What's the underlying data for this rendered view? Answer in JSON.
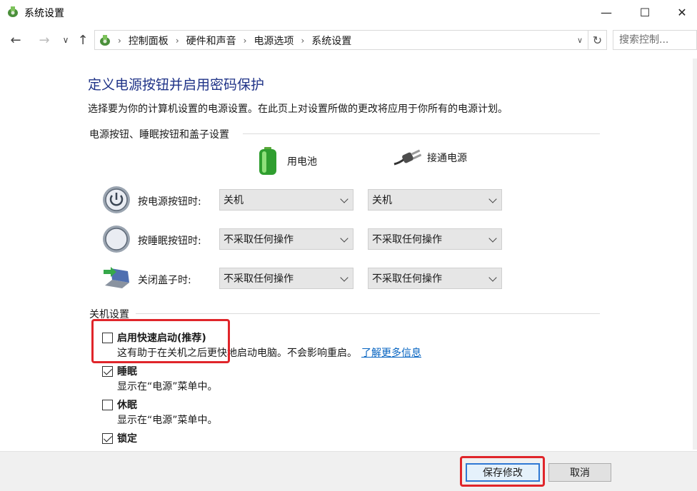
{
  "window": {
    "title": "系统设置",
    "minimize_glyph": "—",
    "maximize_glyph": "☐",
    "close_glyph": "✕"
  },
  "nav": {
    "back_glyph": "←",
    "forward_glyph": "→",
    "recent_glyph": "∨",
    "up_glyph": "↑",
    "refresh_glyph": "↻",
    "breadcrumbs": [
      "控制面板",
      "硬件和声音",
      "电源选项",
      "系统设置"
    ],
    "breadcrumb_sep": "›",
    "dropdown_glyph": "∨",
    "search_placeholder": "搜索控制..."
  },
  "main": {
    "title": "定义电源按钮并启用密码保护",
    "description": "选择要为你的计算机设置的电源设置。在此页上对设置所做的更改将应用于你所有的电源计划。",
    "buttons_section": {
      "heading": "电源按钮、睡眠按钮和盖子设置",
      "col_battery": "用电池",
      "col_plugged": "接通电源",
      "rows": [
        {
          "label": "按电源按钮时:",
          "battery": "关机",
          "plugged": "关机",
          "icon": "power-icon"
        },
        {
          "label": "按睡眠按钮时:",
          "battery": "不采取任何操作",
          "plugged": "不采取任何操作",
          "icon": "sleep-icon"
        },
        {
          "label": "关闭盖子时:",
          "battery": "不采取任何操作",
          "plugged": "不采取任何操作",
          "icon": "laptop-lid-icon"
        }
      ]
    },
    "shutdown_section": {
      "heading": "关机设置",
      "options": [
        {
          "label": "启用快速启动(推荐)",
          "checked": false,
          "desc": "这有助于在关机之后更快地启动电脑。不会影响重启。",
          "link": "了解更多信息"
        },
        {
          "label": "睡眠",
          "checked": true,
          "desc": "显示在“电源”菜单中。"
        },
        {
          "label": "休眠",
          "checked": false,
          "desc": "显示在“电源”菜单中。"
        },
        {
          "label": "锁定",
          "checked": true
        }
      ]
    }
  },
  "footer": {
    "save_label": "保存修改",
    "cancel_label": "取消"
  },
  "colors": {
    "title_blue": "#1e3287",
    "link_blue": "#0563c1",
    "highlight_red": "#e0252a",
    "default_button_border": "#2f78d4"
  }
}
